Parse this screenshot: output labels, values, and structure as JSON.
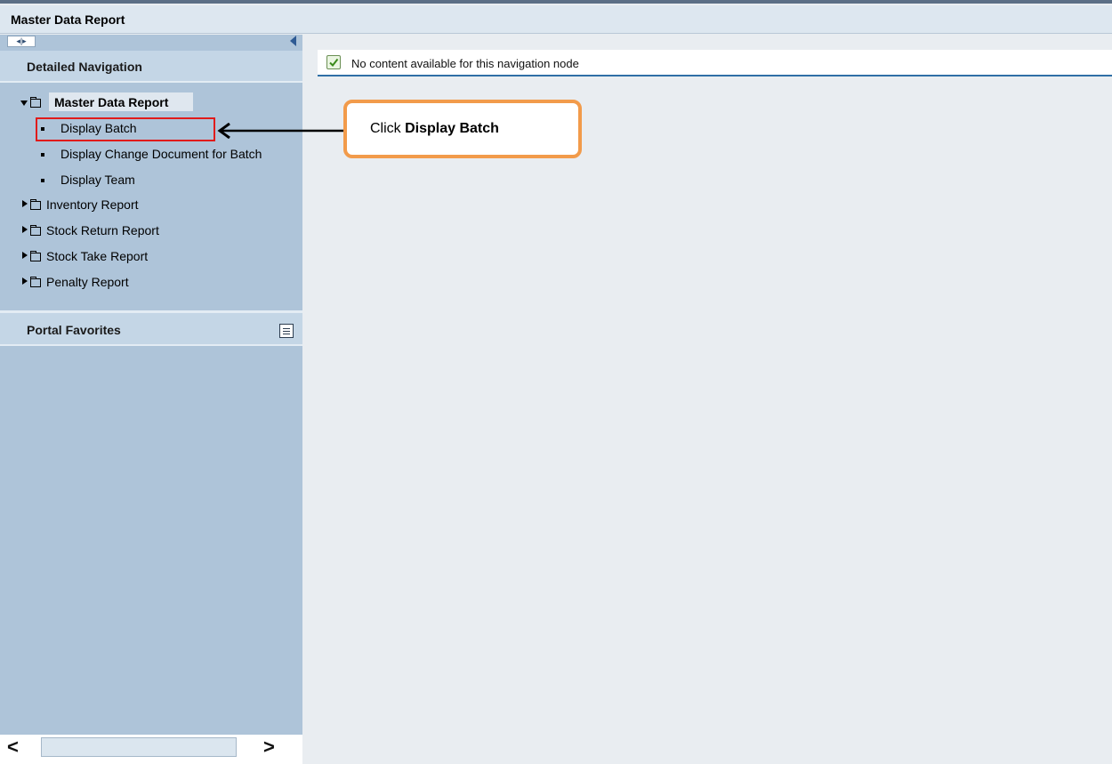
{
  "window": {
    "title": "Master Data Report"
  },
  "sidebar": {
    "detailed_navigation": "Detailed Navigation",
    "root": "Master Data Report",
    "children": [
      "Display Batch",
      "Display Change Document for Batch",
      "Display Team"
    ],
    "folders": [
      "Inventory Report",
      "Stock Return Report",
      "Stock Take Report",
      "Penalty Report"
    ],
    "portal_favorites": "Portal Favorites"
  },
  "content": {
    "message": "No content available for this navigation node"
  },
  "callout": {
    "prefix": "Click ",
    "target": "Display Batch"
  },
  "colors": {
    "highlight_border": "#e01b1b",
    "callout_border": "#f29b4b",
    "sidebar_bg": "#aec4d9"
  }
}
